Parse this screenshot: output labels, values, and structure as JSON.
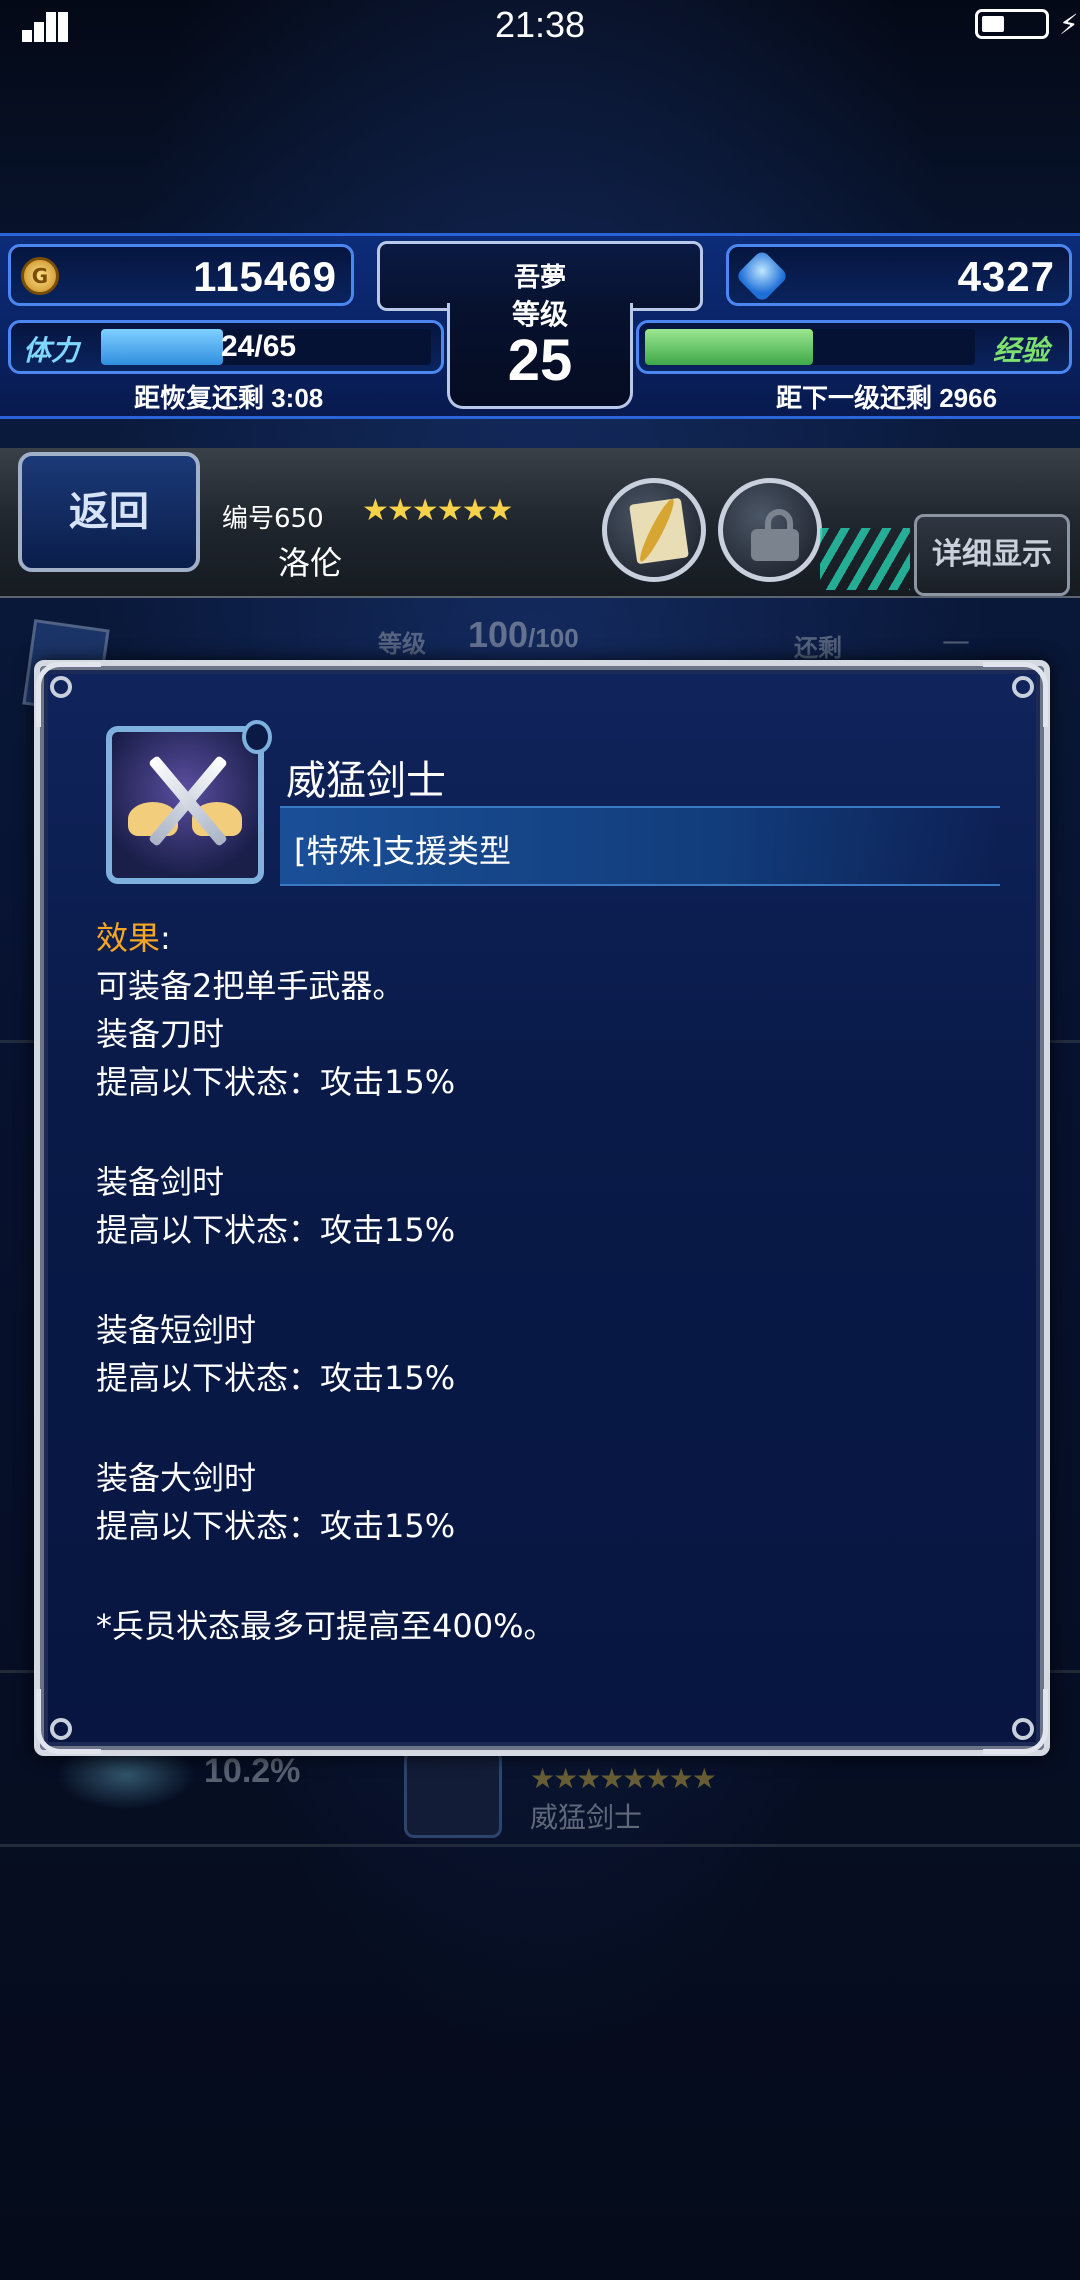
{
  "status_bar": {
    "time": "21:38"
  },
  "hud": {
    "gil": "115469",
    "gems": "4327",
    "player_name": "吾夢",
    "level_label": "等级",
    "level": "25",
    "stamina_label": "体力",
    "stamina_text": "24/65",
    "stamina_fraction": 0.37,
    "stamina_recover": "距恢复还剩 3:08",
    "exp_label": "经验",
    "exp_fraction": 0.51,
    "exp_remain": "距下一级还剩 2966"
  },
  "unit_header": {
    "back_label": "返回",
    "unit_number": "编号650",
    "stars": "★★★★★★",
    "unit_name": "洛伦",
    "detail_label": "详细显示"
  },
  "background_page": {
    "level_label": "等级",
    "level_value": "100",
    "level_max": "/100",
    "remain_label": "还剩",
    "remain_value": "—",
    "percent": "10.2%",
    "ability_stars": "★★★★★★★★",
    "ability_name": "威猛剑士"
  },
  "ability_modal": {
    "title": "威猛剑士",
    "type": "[特殊]支援类型",
    "effect_label": "效果",
    "effect_colon": ":",
    "lines": [
      "可装备2把单手武器。",
      "装备刀时",
      "提高以下状态：攻击15%",
      "",
      "装备剑时",
      "提高以下状态：攻击15%",
      "",
      "装备短剑时",
      "提高以下状态：攻击15%",
      "",
      "装备大剑时",
      "提高以下状态：攻击15%",
      "",
      "*兵员状态最多可提高至400%。"
    ]
  },
  "colors": {
    "accent_blue": "#2b64d8",
    "effect_orange": "#f5a623",
    "stamina_bar": "#3aa8f0",
    "exp_bar": "#6fcf6a"
  }
}
